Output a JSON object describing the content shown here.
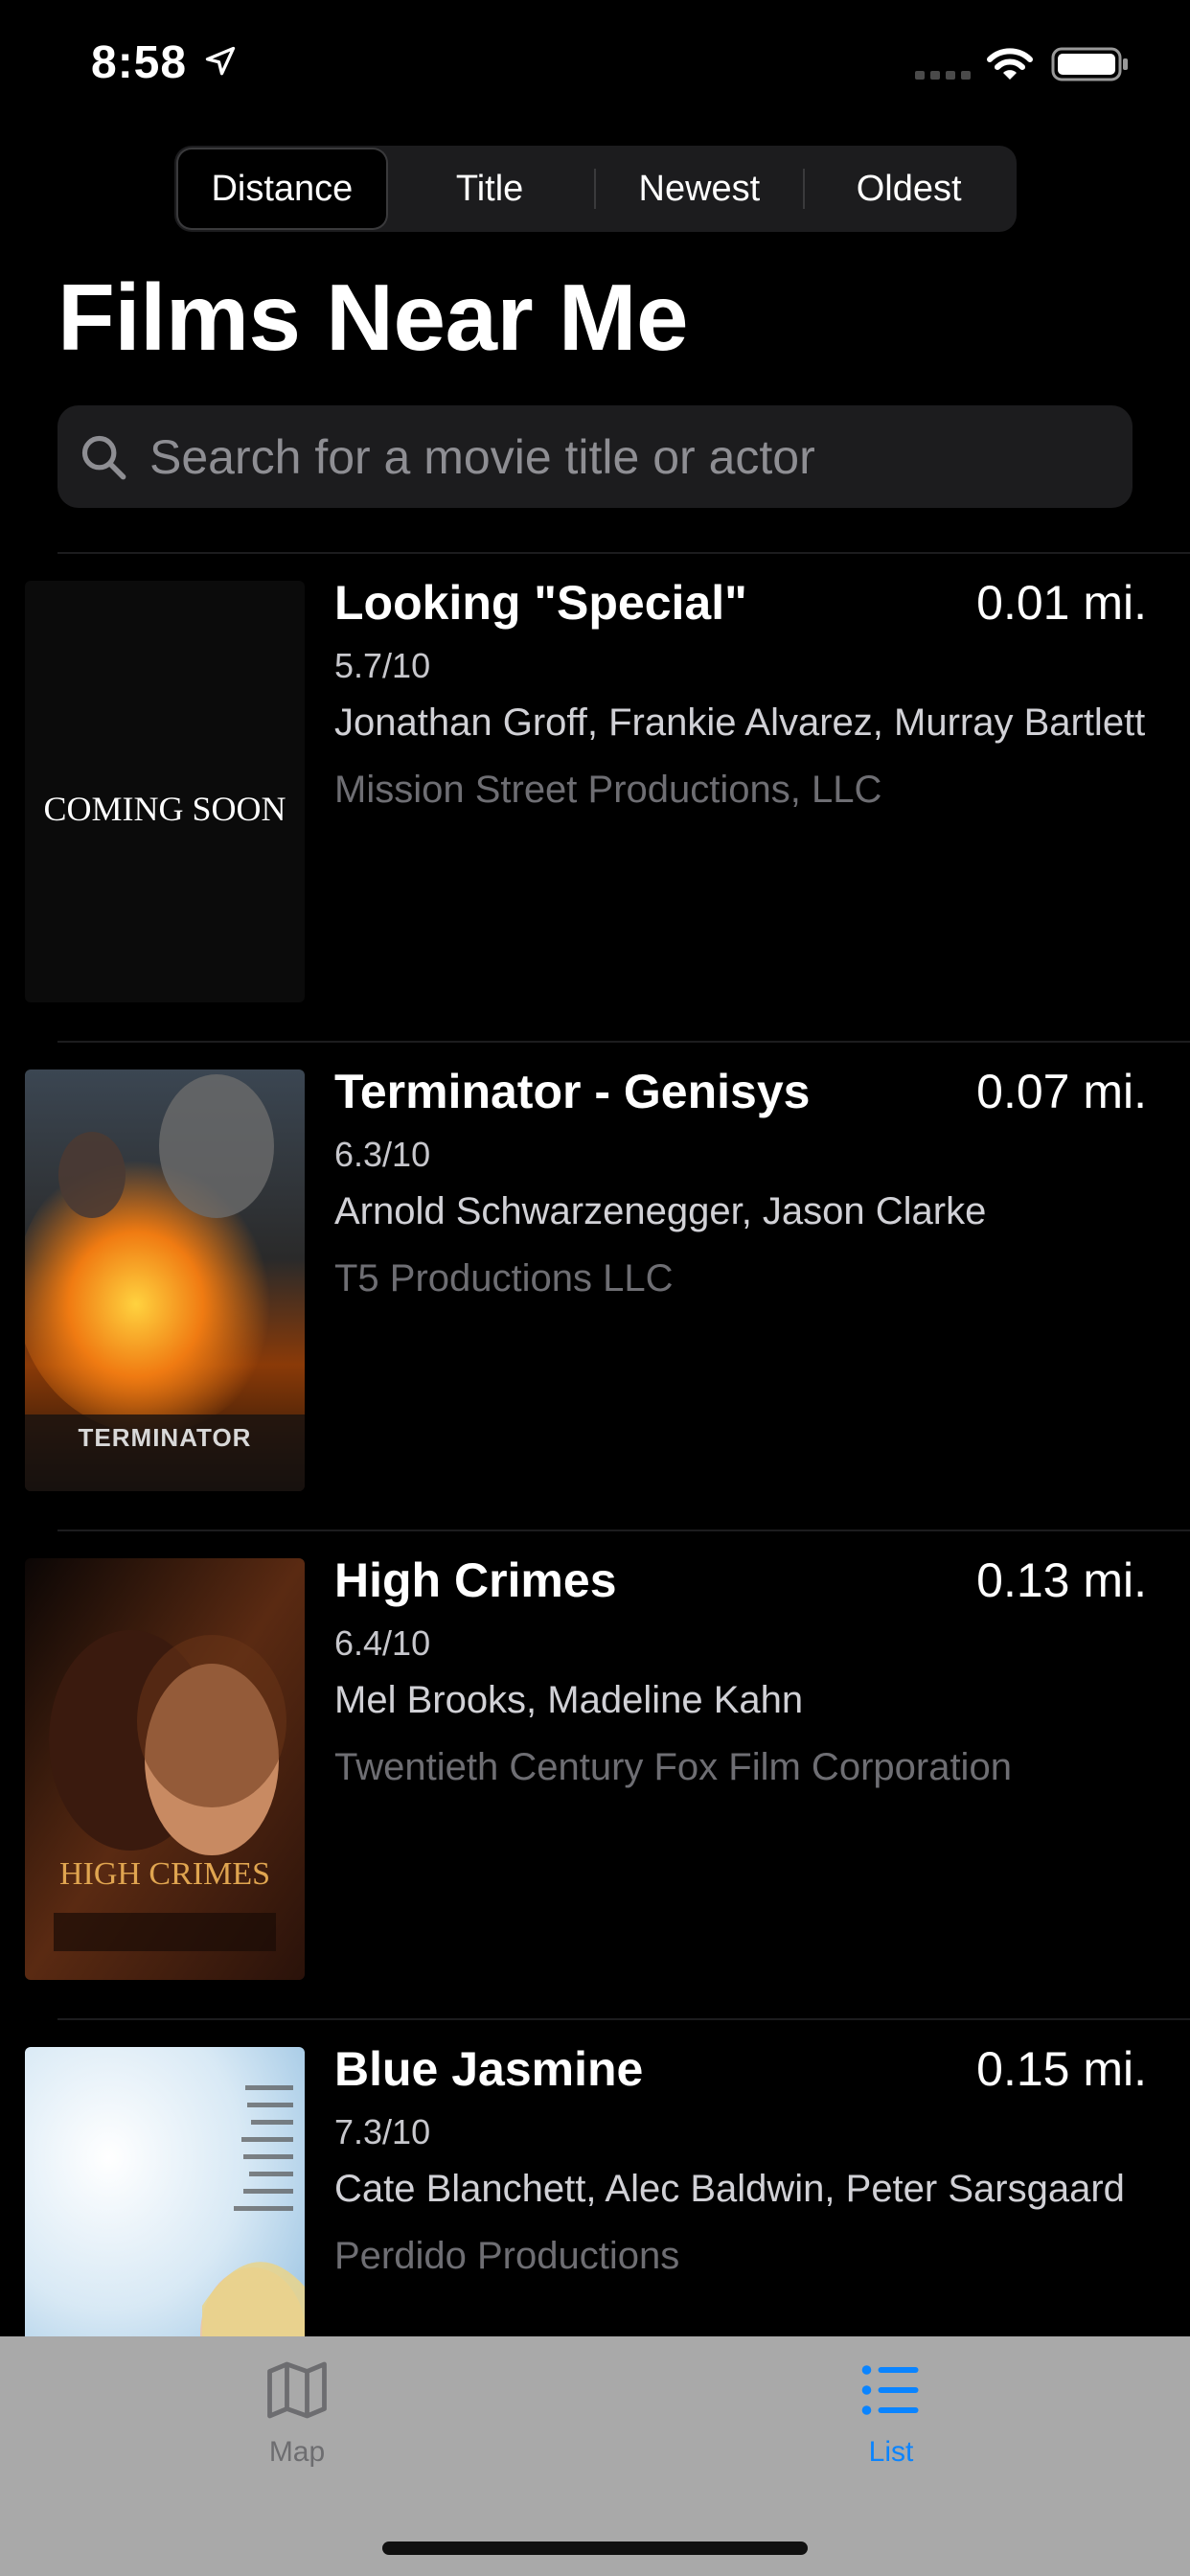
{
  "status_bar": {
    "time": "8:58",
    "icons": [
      "location-arrow-icon",
      "signal-icon",
      "wifi-icon",
      "battery-icon"
    ]
  },
  "sort_control": {
    "options": [
      "Distance",
      "Title",
      "Newest",
      "Oldest"
    ],
    "selected": "Distance"
  },
  "page_title": "Films Near Me",
  "search": {
    "placeholder": "Search for a movie title or actor",
    "value": ""
  },
  "films": [
    {
      "title": "Looking \"Special\"",
      "distance": "0.01 mi.",
      "rating": "5.7/10",
      "cast": "Jonathan Groff, Frankie Alvarez, Murray Bartlett",
      "studio": "Mission Street Productions, LLC",
      "poster_text": "COMING SOON"
    },
    {
      "title": "Terminator - Genisys",
      "distance": "0.07 mi.",
      "rating": "6.3/10",
      "cast": "Arnold Schwarzenegger, Jason Clarke",
      "studio": "T5 Productions LLC",
      "poster_text": "TERMINATOR"
    },
    {
      "title": "High Crimes",
      "distance": "0.13 mi.",
      "rating": "6.4/10",
      "cast": "Mel Brooks, Madeline Kahn",
      "studio": "Twentieth Century Fox Film Corporation",
      "poster_text": "HIGH CRIMES"
    },
    {
      "title": "Blue Jasmine",
      "distance": "0.15 mi.",
      "rating": "7.3/10",
      "cast": "Cate Blanchett, Alec Baldwin, Peter Sarsgaard",
      "studio": "Perdido Productions",
      "poster_text": ""
    }
  ],
  "tabs": [
    {
      "label": "Map",
      "icon": "map-icon",
      "selected": false
    },
    {
      "label": "List",
      "icon": "list-icon",
      "selected": true
    }
  ],
  "colors": {
    "background": "#000000",
    "accent": "#0a84ff",
    "tab_bar": "#a9a9a9",
    "secondary_text": "#6e6e73"
  }
}
